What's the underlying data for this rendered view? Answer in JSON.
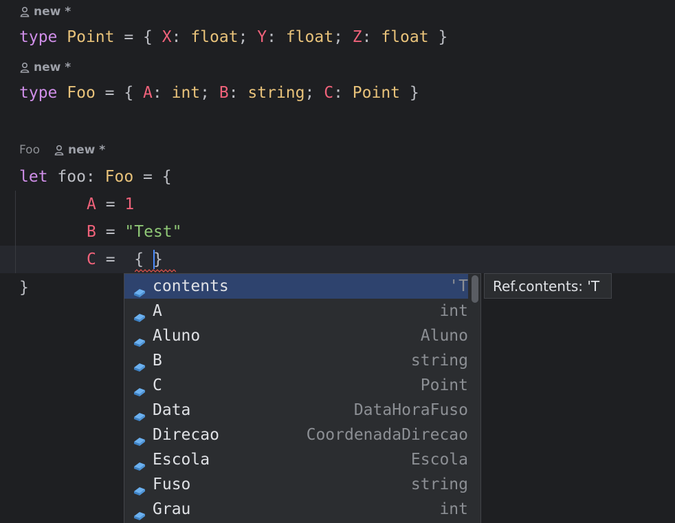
{
  "inlay_hints": [
    {
      "context": "",
      "author": "new *"
    },
    {
      "context": "",
      "author": "new *"
    },
    {
      "context": "Foo",
      "author": "new *"
    }
  ],
  "code": {
    "line1": {
      "kw": "type",
      "name": "Point",
      "eq": " = { ",
      "f1": "X",
      "t1": "float",
      "f2": "Y",
      "t2": "float",
      "f3": "Z",
      "t3": "float",
      "end": " }"
    },
    "line2": {
      "kw": "type",
      "name": "Foo",
      "eq": " = { ",
      "f1": "A",
      "t1": "int",
      "f2": "B",
      "t2": "string",
      "f3": "C",
      "t3": "Point",
      "end": " }"
    },
    "line3": {
      "kw": "let",
      "var": " foo: ",
      "type": "Foo",
      "rest": " = {"
    },
    "line4": {
      "field": "A",
      "eq": " = ",
      "val": "1"
    },
    "line5": {
      "field": "B",
      "eq": " = ",
      "val": "\"Test\""
    },
    "line6": {
      "field": "C",
      "eq": " =  { ",
      "close": "}"
    },
    "line7": {
      "text": "}"
    }
  },
  "completion": {
    "items": [
      {
        "name": "contents",
        "type": "'T",
        "selected": true
      },
      {
        "name": "A",
        "type": "int"
      },
      {
        "name": "Aluno",
        "type": "Aluno"
      },
      {
        "name": "B",
        "type": "string"
      },
      {
        "name": "C",
        "type": "Point"
      },
      {
        "name": "Data",
        "type": "DataHoraFuso"
      },
      {
        "name": "Direcao",
        "type": "CoordenadaDirecao"
      },
      {
        "name": "Escola",
        "type": "Escola"
      },
      {
        "name": "Fuso",
        "type": "string"
      },
      {
        "name": "Grau",
        "type": "int"
      }
    ],
    "icon": "field-icon",
    "doc": "Ref.contents: 'T"
  },
  "colors": {
    "background": "#1e1f22",
    "keyword": "#cf8ee8",
    "type": "#e8c27a",
    "field": "#f0627a",
    "string": "#8fc776",
    "selection": "#2e436e",
    "caret": "#4a8cff"
  }
}
